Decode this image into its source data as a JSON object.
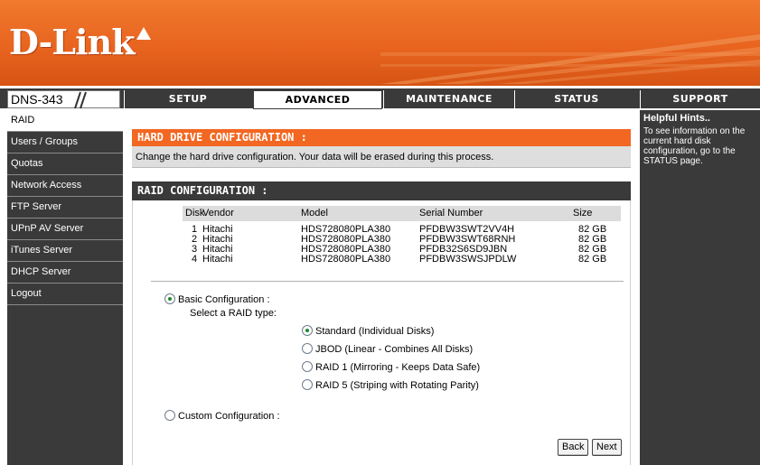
{
  "brand": {
    "logo_text": "D-Link"
  },
  "nav": {
    "model": "DNS-343",
    "tabs": [
      {
        "label": "SETUP",
        "active": false
      },
      {
        "label": "ADVANCED",
        "active": true
      },
      {
        "label": "MAINTENANCE",
        "active": false
      },
      {
        "label": "STATUS",
        "active": false
      },
      {
        "label": "SUPPORT",
        "active": false
      }
    ]
  },
  "sidebar": {
    "items": [
      {
        "label": "RAID",
        "active": true
      },
      {
        "label": "Users / Groups"
      },
      {
        "label": "Quotas"
      },
      {
        "label": "Network Access"
      },
      {
        "label": "FTP Server"
      },
      {
        "label": "UPnP AV Server"
      },
      {
        "label": "iTunes Server"
      },
      {
        "label": "DHCP Server"
      },
      {
        "label": "Logout"
      }
    ]
  },
  "hard_drive": {
    "title": "HARD DRIVE CONFIGURATION :",
    "description": "Change the hard drive configuration. Your data will be erased during this process."
  },
  "raid": {
    "title": "RAID CONFIGURATION :",
    "columns": {
      "disk": "Disk",
      "vendor": "Vendor",
      "model": "Model",
      "serial": "Serial Number",
      "size": "Size"
    },
    "disks": [
      {
        "disk": "1",
        "vendor": "Hitachi",
        "model": "HDS728080PLA380",
        "serial": "PFDBW3SWT2VV4H",
        "size": "82 GB"
      },
      {
        "disk": "2",
        "vendor": "Hitachi",
        "model": "HDS728080PLA380",
        "serial": "PFDBW3SWT68RNH",
        "size": "82 GB"
      },
      {
        "disk": "3",
        "vendor": "Hitachi",
        "model": "HDS728080PLA380",
        "serial": "PFDB32S6SD9JBN",
        "size": "82 GB"
      },
      {
        "disk": "4",
        "vendor": "Hitachi",
        "model": "HDS728080PLA380",
        "serial": "PFDBW3SWSJPDLW",
        "size": "82 GB"
      }
    ],
    "basic_label": "Basic Configuration :",
    "select_type_label": "Select a RAID type:",
    "types": [
      {
        "label": "Standard (Individual Disks)",
        "checked": true
      },
      {
        "label": "JBOD (Linear - Combines All Disks)",
        "checked": false
      },
      {
        "label": "RAID 1 (Mirroring - Keeps Data Safe)",
        "checked": false
      },
      {
        "label": "RAID 5 (Striping with Rotating Parity)",
        "checked": false
      }
    ],
    "custom_label": "Custom Configuration :",
    "back_label": "Back",
    "next_label": "Next"
  },
  "help": {
    "title": "Helpful Hints..",
    "text": "To see information on the current hard disk configuration, go to the STATUS page."
  },
  "colors": {
    "orange": "#f26722",
    "dark": "#3a3a3a",
    "light_gray": "#dedede"
  }
}
